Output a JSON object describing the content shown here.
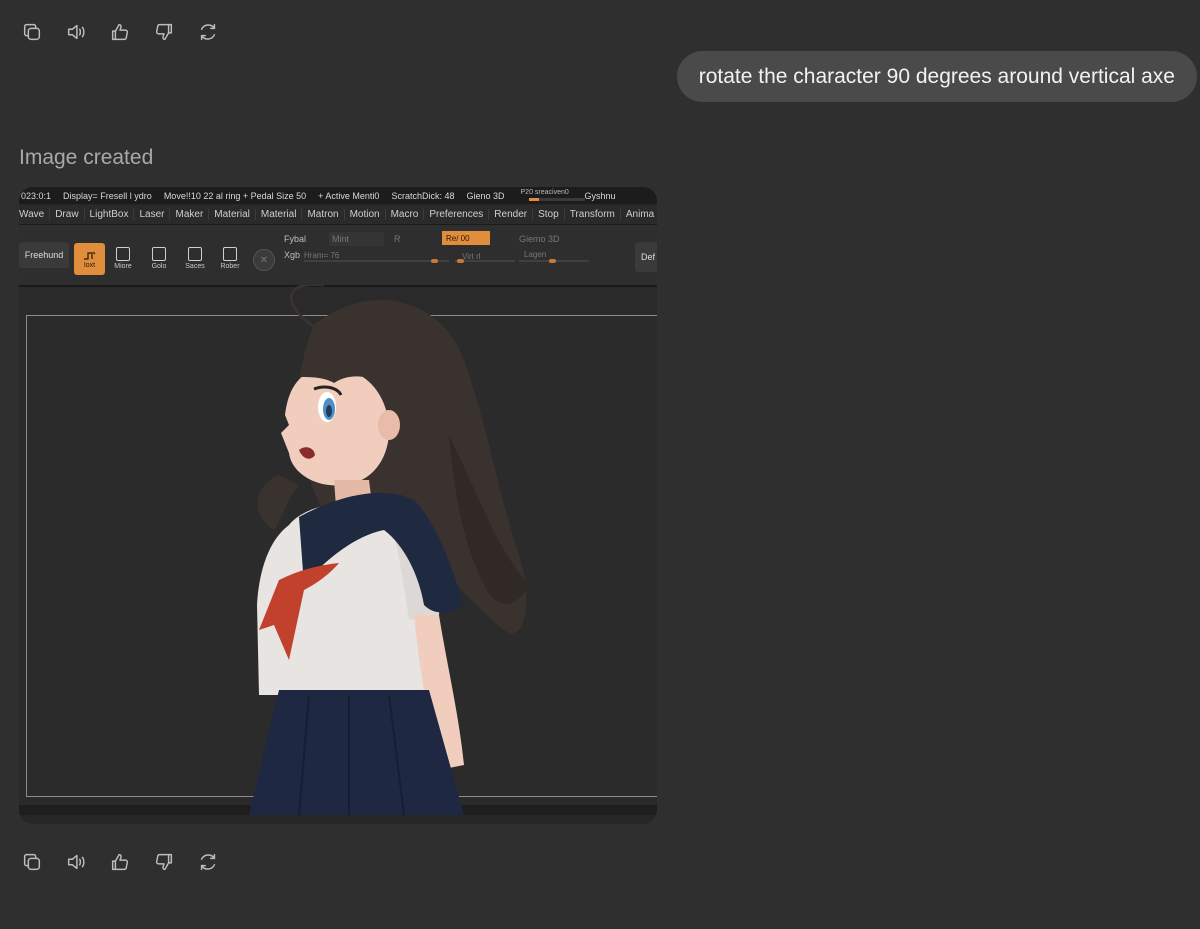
{
  "conversation": {
    "user_message": "rotate the character 90 degrees around vertical axe",
    "assistant_label": "Image created"
  },
  "actions": {
    "copy": "copy-icon",
    "read_aloud": "speaker-icon",
    "good": "thumbs-up-icon",
    "bad": "thumbs-down-icon",
    "regenerate": "refresh-icon"
  },
  "zbrush_ui": {
    "top_bar": [
      "023:0:1",
      "Display= Fresell  l ydro",
      "Move!!10  22 al ring + Pedal Size 50",
      "+ Active Menti0",
      "ScratchDick: 48",
      "Gieno 3D"
    ],
    "progress_label": "P20 sreaciven0",
    "progress_fraction": 0.18,
    "top_right": "Gyshnu",
    "menu": [
      "Wave",
      "Draw",
      "LightBox",
      "Laser",
      "Maker",
      "Material",
      "Material",
      "Matron",
      "Motion",
      "Macro",
      "Preferences",
      "Render",
      "Stop",
      "Transform",
      "Anima"
    ],
    "freehand_label": "Freehund",
    "active_tool_label": "Ioxt",
    "tools": [
      "Miore",
      "Golo",
      "Saces",
      "Rober"
    ],
    "fields": {
      "fybal": "Fybal",
      "mint": "Mint",
      "r": "R",
      "orange_value": "Re/ 00",
      "gizmo": "Giemo 3D",
      "xgb": "Xgb",
      "hram": "Hram= 76",
      "virtrl": "Virt rl",
      "lagen": "Lagen"
    },
    "right_button": "Def"
  },
  "colors": {
    "background": "#2f2f2f",
    "bubble": "#4a4a4a",
    "accent_orange": "#e08d3c"
  }
}
